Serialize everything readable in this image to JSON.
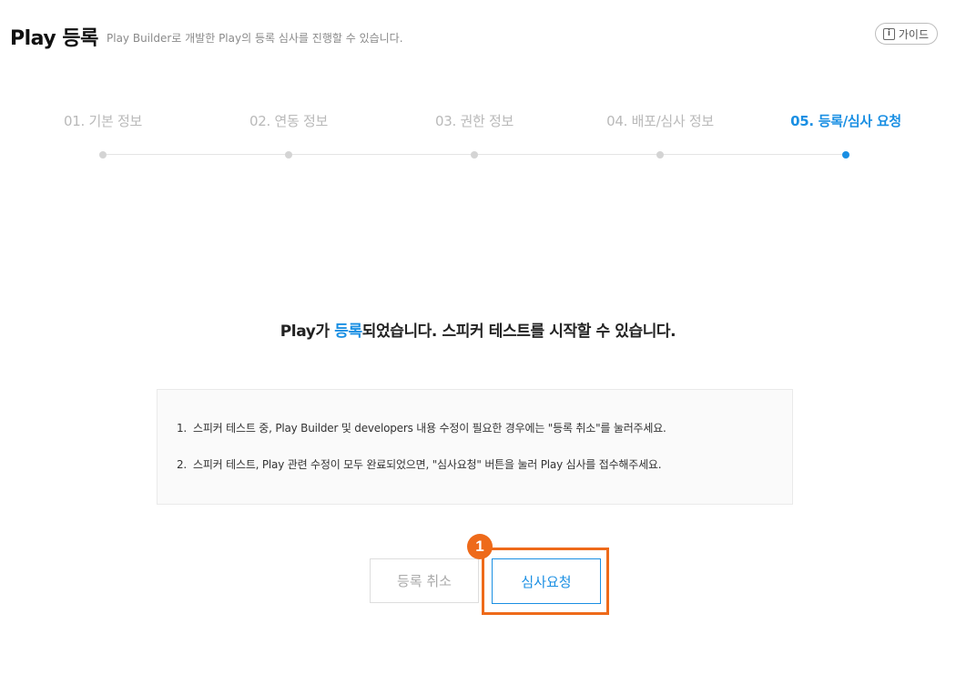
{
  "header": {
    "title": "Play 등록",
    "subtitle": "Play Builder로 개발한 Play의 등록 심사를 진행할 수 있습니다.",
    "guide_label": "가이드",
    "guide_icon": "i"
  },
  "steps": [
    {
      "label": "01. 기본 정보",
      "active": false
    },
    {
      "label": "02. 연동 정보",
      "active": false
    },
    {
      "label": "03. 권한 정보",
      "active": false
    },
    {
      "label": "04. 배포/심사 정보",
      "active": false
    },
    {
      "label": "05. 등록/심사 요청",
      "active": true
    }
  ],
  "message": {
    "prefix": "Play가 ",
    "highlight": "등록",
    "suffix": "되었습니다. 스피커 테스트를 시작할 수 있습니다."
  },
  "notices": [
    {
      "num": "1.",
      "text": "스피커 테스트 중, Play Builder 및 developers 내용 수정이 필요한 경우에는 \"등록 취소\"를 눌러주세요."
    },
    {
      "num": "2.",
      "text": "스피커 테스트, Play 관련 수정이 모두 완료되었으면, \"심사요청\" 버튼을 눌러 Play 심사를 접수해주세요."
    }
  ],
  "buttons": {
    "cancel_label": "등록 취소",
    "request_label": "심사요청"
  },
  "callout": {
    "number": "1"
  },
  "colors": {
    "accent": "#1a8fe3",
    "callout": "#ee6a1a",
    "inactive_step": "#b9b9b9"
  }
}
